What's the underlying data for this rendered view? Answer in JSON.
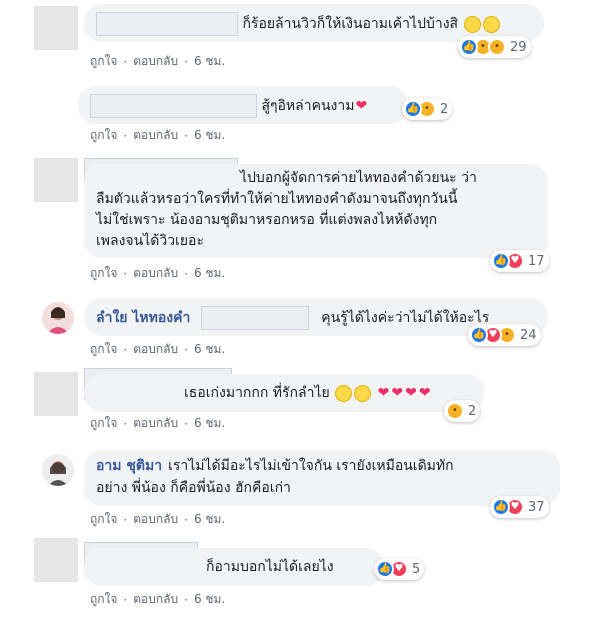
{
  "comments": [
    {
      "text": "ก็ร้อยล้านวิวก็ให้เงินอามเค้าไปบ้างสิ",
      "reactions": "29",
      "like": "ถูกใจ",
      "reply": "ตอบกลับ",
      "time": "6 ชม."
    },
    {
      "text": "สู้ๆอิหล่าคนงาม",
      "reactions": "2",
      "like": "ถูกใจ",
      "reply": "ตอบกลับ",
      "time": "6 ชม."
    },
    {
      "lines": [
        "ไปบอกผู้จัดการค่ายไหทองคำด้วยนะ ว่า",
        "ลืมตัวแล้วหรอว่าใครที่ทำให้ค่ายไหทองคำดังมาจนถึงทุกวันนี้",
        "ไม่ใช่เพราะ น้องอามชุติมาหรอกหรอ ที่แต่งพลงไหห้ดังทุก",
        "เพลงจนได้วิวเยอะ"
      ],
      "reactions": "17",
      "like": "ถูกใจ",
      "reply": "ตอบกลับ",
      "time": "6 ชม."
    },
    {
      "author": "ลำใย ไหทองคำ",
      "text": "คุนรู้ได้ไงค่ะว่าไม่ได้ให้อะไร",
      "reactions": "24",
      "like": "ถูกใจ",
      "reply": "ตอบกลับ",
      "time": "6 ชม."
    },
    {
      "text": "เธอเก่งมากกก ที่รักลำไย",
      "reactions": "2",
      "like": "ถูกใจ",
      "reply": "ตอบกลับ",
      "time": "6 ชม."
    },
    {
      "author": "อาม ชุติมา",
      "lines": [
        "เราไม่ได้มีอะไรไม่เข้าใจกัน เรายังเหมือนเดิมทัก",
        "อย่าง พี่น้อง ก็คือพี่น้อง ฮักคือเก่า"
      ],
      "reactions": "37",
      "like": "ถูกใจ",
      "reply": "ตอบกลับ",
      "time": "6 ชม."
    },
    {
      "text": "ก็อามบอกไม่ได้เลยไง",
      "reactions": "5",
      "like": "ถูกใจ",
      "reply": "ตอบกลับ",
      "time": "6 ชม."
    }
  ],
  "icons": {
    "like": "like-reaction-icon",
    "love": "love-reaction-icon",
    "haha": "haha-reaction-icon"
  },
  "colors": {
    "like": "#1877f2",
    "love": "#f33e58",
    "haha": "#f7b125",
    "author": "#385898"
  }
}
